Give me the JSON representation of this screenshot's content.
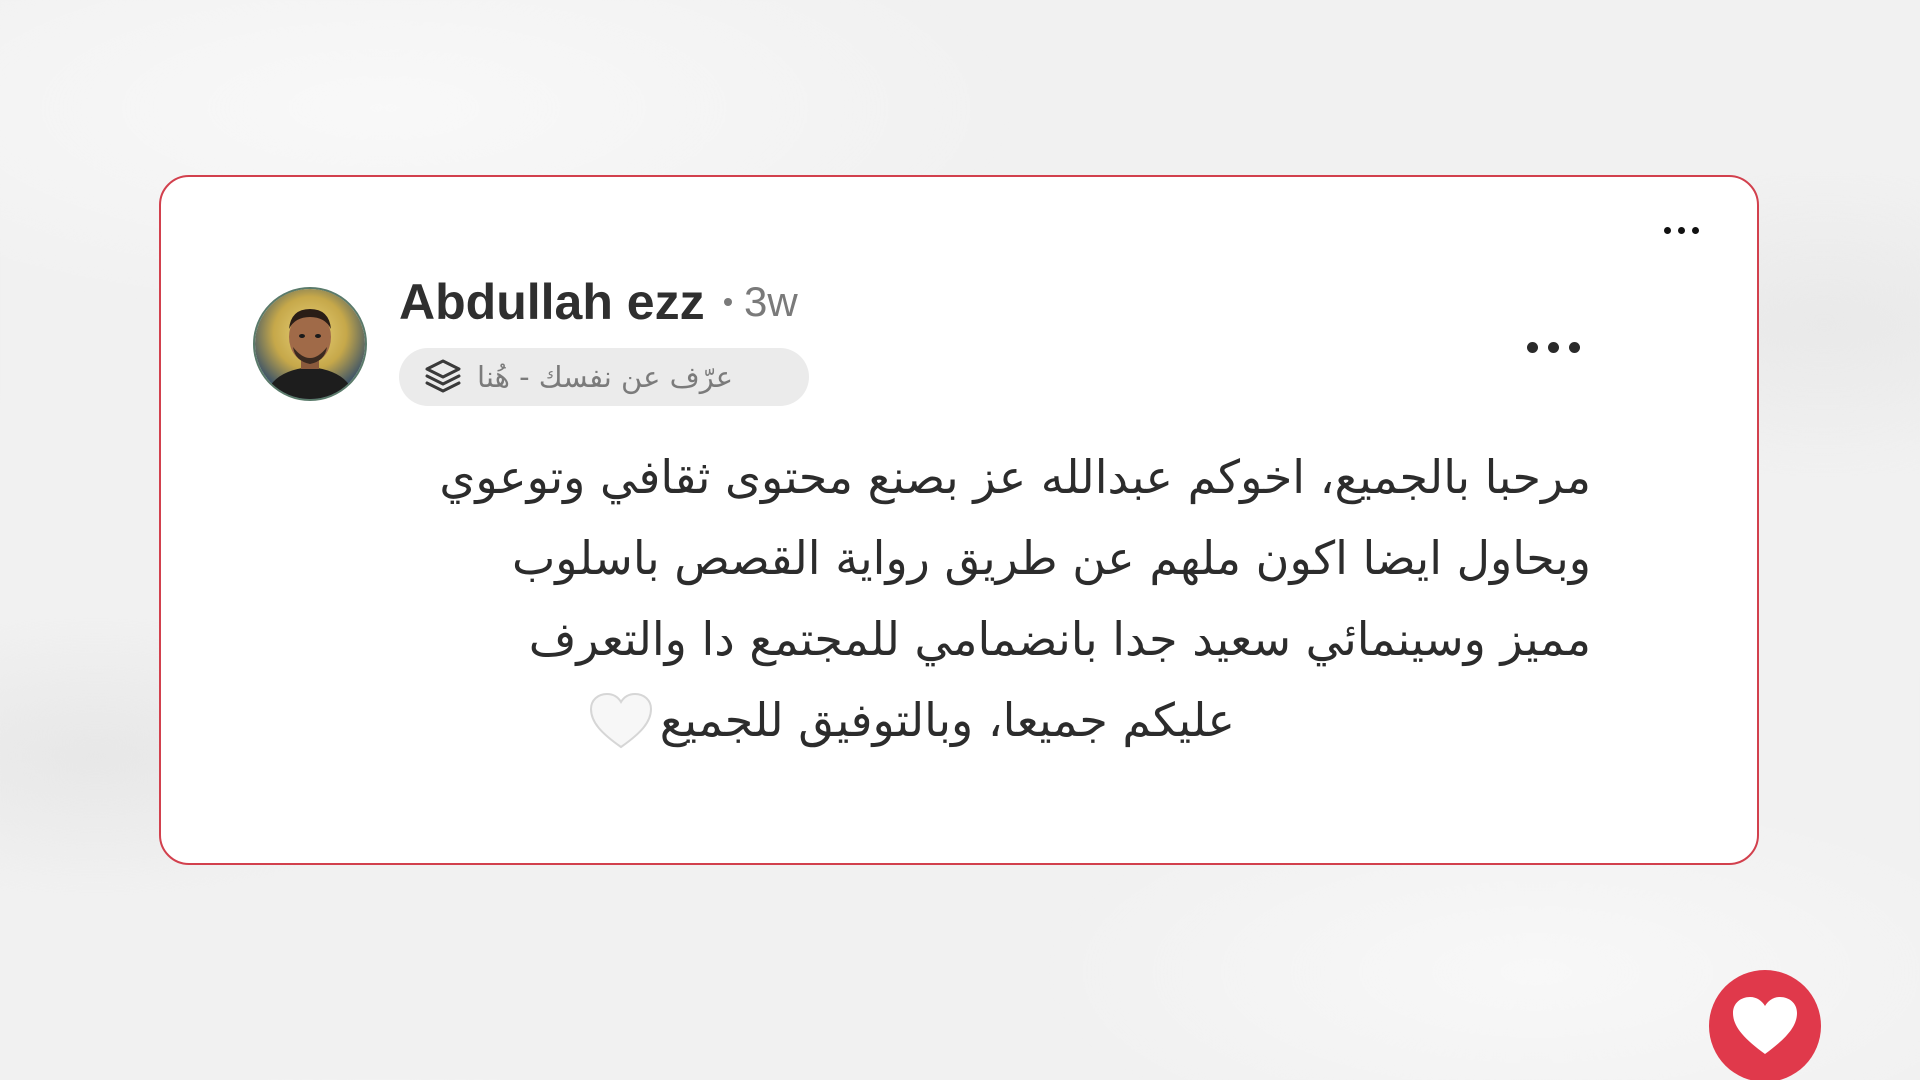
{
  "post": {
    "author": "Abdullah ezz",
    "time": "3w",
    "bio_prompt": "عرّف عن نفسك - هُنا",
    "lines": [
      "مرحبا بالجميع، اخوكم عبدالله عز بصنع محتوى ثقافي وتوعوي",
      "وبحاول ايضا اكون ملهم عن طريق رواية القصص باسلوب",
      "مميز وسينمائي سعيد جدا بانضمامي للمجتمع دا والتعرف",
      "عليكم جميعا، وبالتوفيق للجميع"
    ],
    "trailing_emoji": "white-heart"
  },
  "icons": {
    "more": "more-horizontal-icon",
    "bio": "layers-icon",
    "like": "heart-icon"
  },
  "colors": {
    "accent": "#e0394b",
    "card_border": "#d2404d",
    "text": "#2c2c2c",
    "muted": "#7a7a7a",
    "pill_bg": "#ebebeb"
  }
}
